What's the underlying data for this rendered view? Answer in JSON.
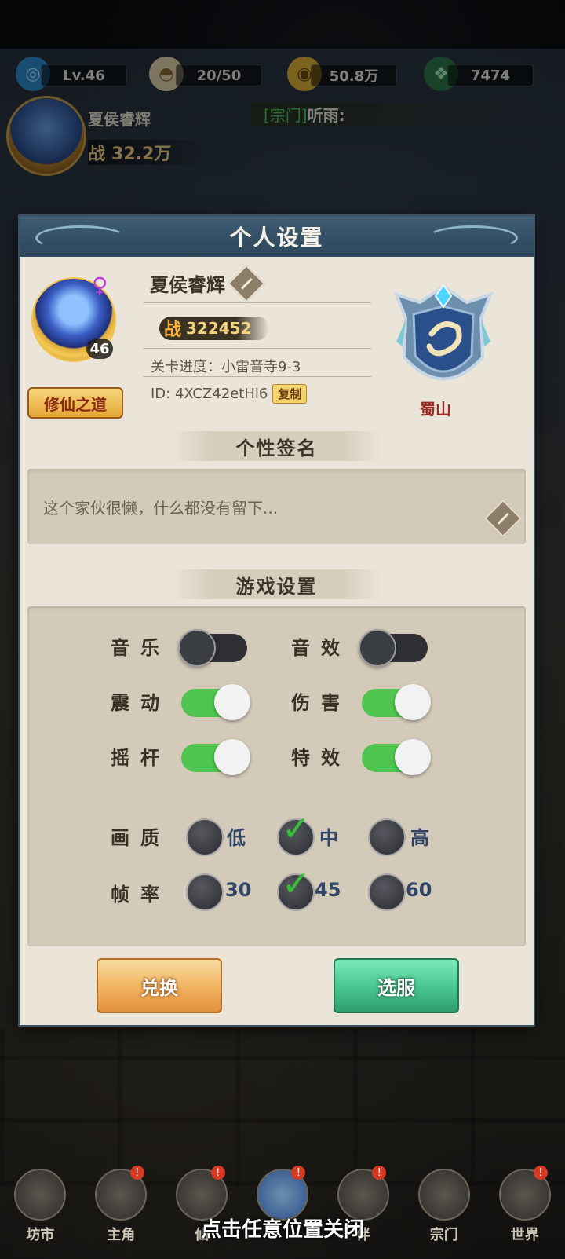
{
  "top_bar": {
    "level": "Lv.46",
    "stamina": "20/50",
    "coins": "50.8万",
    "jade": "7474"
  },
  "player": {
    "name": "夏侯睿辉",
    "power_char": "战",
    "power": "32.2万"
  },
  "chat": {
    "tag": "[宗门]",
    "text": "听雨:"
  },
  "modal": {
    "title": "个人设置",
    "avatar_level": "46",
    "gender_symbol": "♀",
    "title_badge": "修仙之道",
    "nickname": "夏侯睿辉",
    "power_char": "战",
    "power": "322452",
    "stage_progress": "关卡进度：小雷音寺9-3",
    "id_text": "ID: 4XCZ42etHl6",
    "copy_label": "复制",
    "sect_name": "蜀山",
    "signature_heading": "个性签名",
    "signature_text": "这个家伙很懒，什么都没有留下...",
    "game_settings_heading": "游戏设置",
    "settings": {
      "music": {
        "label": "音乐",
        "on": false
      },
      "sfx": {
        "label": "音效",
        "on": false
      },
      "vibration": {
        "label": "震动",
        "on": true
      },
      "damage": {
        "label": "伤害",
        "on": true
      },
      "joystick": {
        "label": "摇杆",
        "on": true
      },
      "effects": {
        "label": "特效",
        "on": true
      }
    },
    "quality": {
      "label": "画质",
      "options": [
        "低",
        "中",
        "高"
      ],
      "selected": "中"
    },
    "framerate": {
      "label": "帧率",
      "options": [
        "30",
        "45",
        "60"
      ],
      "selected": "45"
    },
    "redeem_label": "兑换",
    "server_label": "选服"
  },
  "nav": {
    "items": [
      {
        "label": "坊市",
        "badge": ""
      },
      {
        "label": "主角",
        "badge": "!"
      },
      {
        "label": "仙",
        "badge": "!"
      },
      {
        "label": "",
        "badge": "!"
      },
      {
        "label": "伴",
        "badge": "!"
      },
      {
        "label": "宗门",
        "badge": ""
      },
      {
        "label": "世界",
        "badge": "!"
      }
    ]
  },
  "close_hint": "点击任意位置关闭",
  "colors": {
    "toggle_on": "#4fc54f",
    "toggle_off": "#2d2f33",
    "check": "#35c135",
    "sect_red": "#9b2a22",
    "header_blue": "#3d5c74"
  }
}
